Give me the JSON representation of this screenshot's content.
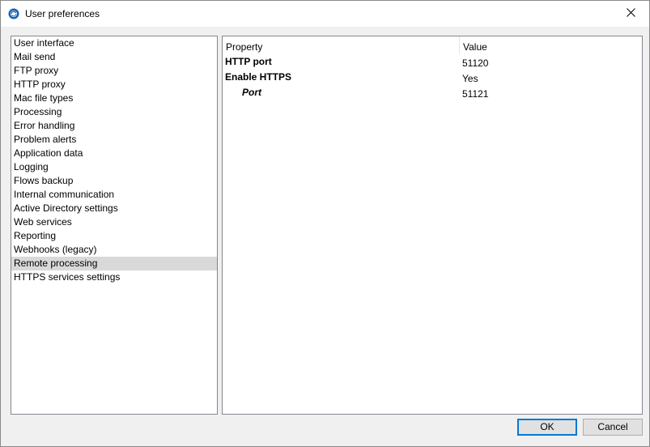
{
  "window": {
    "title": "User preferences",
    "app_icon": "circular-arrows-app-icon",
    "close_icon": "close-icon"
  },
  "nav": {
    "items": [
      {
        "label": "User interface"
      },
      {
        "label": "Mail send"
      },
      {
        "label": "FTP proxy"
      },
      {
        "label": "HTTP proxy"
      },
      {
        "label": "Mac file types"
      },
      {
        "label": "Processing"
      },
      {
        "label": "Error handling"
      },
      {
        "label": "Problem alerts"
      },
      {
        "label": "Application data"
      },
      {
        "label": "Logging"
      },
      {
        "label": "Flows backup"
      },
      {
        "label": "Internal communication"
      },
      {
        "label": "Active Directory settings"
      },
      {
        "label": "Web services"
      },
      {
        "label": "Reporting"
      },
      {
        "label": "Webhooks (legacy)"
      },
      {
        "label": "Remote processing"
      },
      {
        "label": "HTTPS services settings"
      }
    ],
    "selected_label": "Remote processing"
  },
  "grid": {
    "header_property": "Property",
    "header_value": "Value",
    "rows": [
      {
        "name": "HTTP port",
        "value": "51120"
      },
      {
        "name": "Enable HTTPS",
        "value": "Yes"
      },
      {
        "name": "Port",
        "value": "51121"
      }
    ]
  },
  "buttons": {
    "ok": "OK",
    "cancel": "Cancel"
  },
  "colors": {
    "selection": "#d9d9d9",
    "default_button_border": "#0078d7",
    "icon_blue": "#1a5fb4"
  }
}
